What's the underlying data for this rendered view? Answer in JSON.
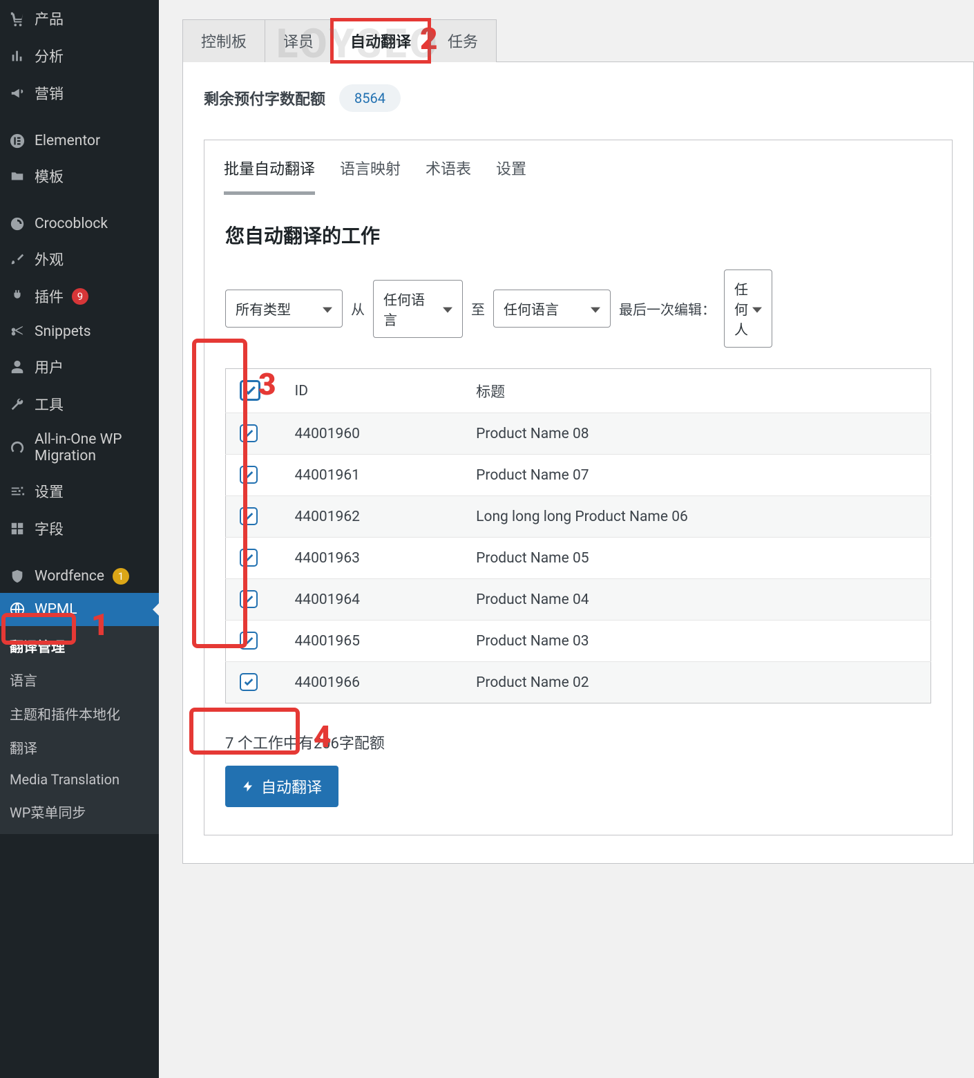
{
  "watermark": "LOYSEO",
  "sidebar": {
    "items": [
      {
        "label": "产品",
        "icon": "cart",
        "badge": null
      },
      {
        "label": "分析",
        "icon": "bars",
        "badge": null
      },
      {
        "label": "营销",
        "icon": "megaphone",
        "badge": null
      },
      {
        "label": "Elementor",
        "icon": "elementor",
        "badge": null,
        "sep": true
      },
      {
        "label": "模板",
        "icon": "folder",
        "badge": null
      },
      {
        "label": "Crocoblock",
        "icon": "croco",
        "badge": null,
        "sep": true
      },
      {
        "label": "外观",
        "icon": "brush",
        "badge": null
      },
      {
        "label": "插件",
        "icon": "plug",
        "badge": {
          "text": "9",
          "color": "red"
        }
      },
      {
        "label": "Snippets",
        "icon": "scissors",
        "badge": null
      },
      {
        "label": "用户",
        "icon": "user",
        "badge": null
      },
      {
        "label": "工具",
        "icon": "wrench",
        "badge": null
      },
      {
        "label": "All-in-One WP Migration",
        "icon": "spinner",
        "badge": null
      },
      {
        "label": "设置",
        "icon": "sliders",
        "badge": null
      },
      {
        "label": "字段",
        "icon": "grid",
        "badge": null
      },
      {
        "label": "Wordfence",
        "icon": "shield",
        "badge": {
          "text": "1",
          "color": "orange"
        },
        "sep": true
      },
      {
        "label": "WPML",
        "icon": "globe",
        "badge": null,
        "active": true
      }
    ],
    "sub": [
      {
        "label": "翻译管理",
        "current": true
      },
      {
        "label": "语言"
      },
      {
        "label": "主题和插件本地化"
      },
      {
        "label": "翻译"
      },
      {
        "label": "Media Translation"
      },
      {
        "label": "WP菜单同步"
      }
    ]
  },
  "top_tabs": [
    {
      "label": "控制板"
    },
    {
      "label": "译员"
    },
    {
      "label": "自动翻译",
      "active": true,
      "highlight": true
    },
    {
      "label": "任务"
    }
  ],
  "quota": {
    "label": "剩余预付字数配额",
    "value": "8564"
  },
  "subtabs": [
    {
      "label": "批量自动翻译",
      "active": true
    },
    {
      "label": "语言映射"
    },
    {
      "label": "术语表"
    },
    {
      "label": "设置"
    }
  ],
  "jobs": {
    "title": "您自动翻译的工作",
    "filters": {
      "type": "所有类型",
      "from_label": "从",
      "from_lang": "任何语言",
      "to_label": "至",
      "to_lang": "任何语言",
      "last_edit_label": "最后一次编辑：",
      "last_edit_value": "任何人"
    },
    "columns": {
      "id": "ID",
      "title": "标题"
    },
    "rows": [
      {
        "id": "44001960",
        "title": "Product Name 08"
      },
      {
        "id": "44001961",
        "title": "Product Name 07"
      },
      {
        "id": "44001962",
        "title": "Long long long Product Name 06"
      },
      {
        "id": "44001963",
        "title": "Product Name 05"
      },
      {
        "id": "44001964",
        "title": "Product Name 04"
      },
      {
        "id": "44001965",
        "title": "Product Name 03"
      },
      {
        "id": "44001966",
        "title": "Product Name 02"
      }
    ],
    "summary": "7 个工作中有206字配额",
    "auto_button": "自动翻译"
  },
  "annotations": {
    "n1": "1",
    "n2": "2",
    "n3": "3",
    "n4": "4"
  }
}
